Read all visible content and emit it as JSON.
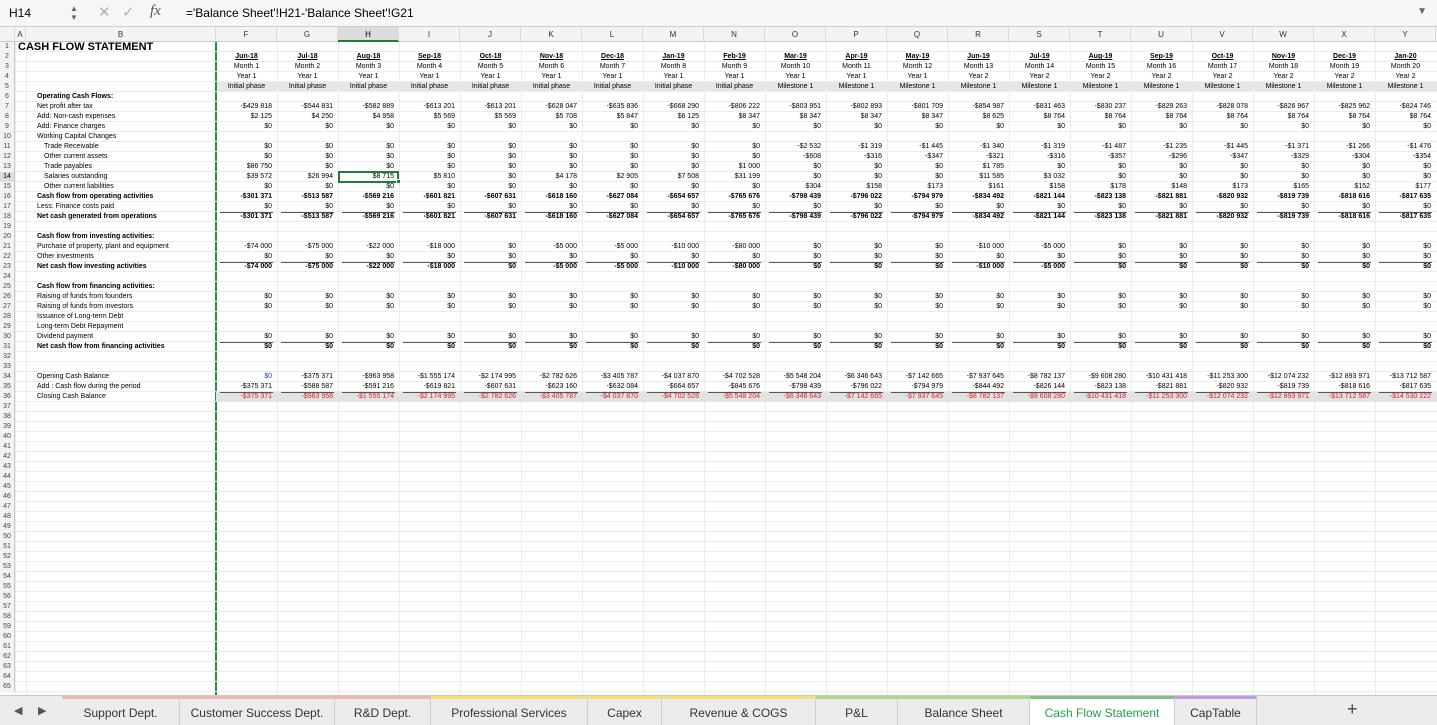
{
  "formula_bar": {
    "name_box": "H14",
    "formula": "='Balance Sheet'!H21-'Balance Sheet'!G21",
    "cancel": "✕",
    "confirm": "✓",
    "fx": "fx"
  },
  "columns": [
    "A",
    "B",
    "F",
    "G",
    "H",
    "I",
    "J",
    "K",
    "L",
    "M",
    "N",
    "O",
    "P",
    "Q",
    "R",
    "S",
    "T",
    "U",
    "V",
    "W",
    "X",
    "Y"
  ],
  "selected_column": "H",
  "selected_row": 14,
  "row_count": 65,
  "title": "CASH FLOW STATEMENT",
  "months": [
    "Jun-18",
    "Jul-18",
    "Aug-18",
    "Sep-18",
    "Oct-18",
    "Nov-18",
    "Dec-18",
    "Jan-19",
    "Feb-19",
    "Mar-19",
    "Apr-19",
    "May-19",
    "Jun-19",
    "Jul-19",
    "Aug-19",
    "Sep-19",
    "Oct-19",
    "Nov-19",
    "Dec-19",
    "Jan-20"
  ],
  "month_numbers": [
    "Month 1",
    "Month 2",
    "Month 3",
    "Month 4",
    "Month 5",
    "Month 6",
    "Month 7",
    "Month 8",
    "Month 9",
    "Month 10",
    "Month 11",
    "Month 12",
    "Month 13",
    "Month 14",
    "Month 15",
    "Month 16",
    "Month 17",
    "Month 18",
    "Month 19",
    "Month 20"
  ],
  "years": [
    "Year 1",
    "Year 1",
    "Year 1",
    "Year 1",
    "Year 1",
    "Year 1",
    "Year 1",
    "Year 1",
    "Year 1",
    "Year 1",
    "Year 1",
    "Year 1",
    "Year 2",
    "Year 2",
    "Year 2",
    "Year 2",
    "Year 2",
    "Year 2",
    "Year 2",
    "Year 2"
  ],
  "phases": [
    "Initial phase",
    "Initial phase",
    "Initial phase",
    "Initial phase",
    "Initial phase",
    "Initial phase",
    "Initial phase",
    "Initial phase",
    "Initial phase",
    "Milestone 1",
    "Milestone 1",
    "Milestone 1",
    "Milestone 1",
    "Milestone 1",
    "Milestone 1",
    "Milestone 1",
    "Milestone 1",
    "Milestone 1",
    "Milestone 1",
    "Milestone 1"
  ],
  "rows": [
    {
      "row": 6,
      "label": "Operating Cash Flows:",
      "style": "bold"
    },
    {
      "row": 7,
      "label": "Net profit after tax",
      "values": [
        "-$429 818",
        "-$544 831",
        "-$582 889",
        "-$613 201",
        "-$613 201",
        "-$628 047",
        "-$635 836",
        "-$668 290",
        "-$806 222",
        "-$803 951",
        "-$802 893",
        "-$801 709",
        "-$854 987",
        "-$831 463",
        "-$830 237",
        "-$829 263",
        "-$828 078",
        "-$826 967",
        "-$825 962",
        "-$824 746"
      ]
    },
    {
      "row": 8,
      "label": "Add: Non-cash expenses",
      "values": [
        "$2 125",
        "$4 250",
        "$4 958",
        "$5 569",
        "$5 569",
        "$5 708",
        "$5 847",
        "$6 125",
        "$8 347",
        "$8 347",
        "$8 347",
        "$8 347",
        "$8 625",
        "$8 764",
        "$8 764",
        "$8 764",
        "$8 764",
        "$8 764",
        "$8 764",
        "$8 764"
      ]
    },
    {
      "row": 9,
      "label": "Add: Finance charges",
      "values": [
        "$0",
        "$0",
        "$0",
        "$0",
        "$0",
        "$0",
        "$0",
        "$0",
        "$0",
        "$0",
        "$0",
        "$0",
        "$0",
        "$0",
        "$0",
        "$0",
        "$0",
        "$0",
        "$0",
        "$0"
      ]
    },
    {
      "row": 10,
      "label": "Working Capital Changes"
    },
    {
      "row": 11,
      "label": "Trade Receivable",
      "indent": true,
      "values": [
        "$0",
        "$0",
        "$0",
        "$0",
        "$0",
        "$0",
        "$0",
        "$0",
        "$0",
        "-$2 532",
        "-$1 319",
        "-$1 445",
        "-$1 340",
        "-$1 319",
        "-$1 487",
        "-$1 235",
        "-$1 445",
        "-$1 371",
        "-$1 266",
        "-$1 476"
      ]
    },
    {
      "row": 12,
      "label": "Other current assets",
      "indent": true,
      "values": [
        "$0",
        "$0",
        "$0",
        "$0",
        "$0",
        "$0",
        "$0",
        "$0",
        "$0",
        "-$608",
        "-$316",
        "-$347",
        "-$321",
        "-$316",
        "-$357",
        "-$296",
        "-$347",
        "-$329",
        "-$304",
        "-$354"
      ]
    },
    {
      "row": 13,
      "label": "Trade payables",
      "indent": true,
      "values": [
        "$86 750",
        "$0",
        "$0",
        "$0",
        "$0",
        "$0",
        "$0",
        "$0",
        "$1 000",
        "$0",
        "$0",
        "$0",
        "$1 785",
        "$0",
        "$0",
        "$0",
        "$0",
        "$0",
        "$0",
        "$0"
      ]
    },
    {
      "row": 14,
      "label": "Salaries outstanding",
      "indent": true,
      "values": [
        "$39 572",
        "$26 994",
        "$8 715",
        "$5 810",
        "$0",
        "$4 178",
        "$2 905",
        "$7 508",
        "$31 199",
        "$0",
        "$0",
        "$0",
        "$11 585",
        "$3 032",
        "$0",
        "$0",
        "$0",
        "$0",
        "$0",
        "$0"
      ]
    },
    {
      "row": 15,
      "label": "Other current liabilities",
      "indent": true,
      "values": [
        "$0",
        "$0",
        "$0",
        "$0",
        "$0",
        "$0",
        "$0",
        "$0",
        "$0",
        "$304",
        "$158",
        "$173",
        "$161",
        "$158",
        "$178",
        "$148",
        "$173",
        "$165",
        "$152",
        "$177"
      ]
    },
    {
      "row": 16,
      "label": "Cash flow from operating activities",
      "style": "bold",
      "values": [
        "-$301 371",
        "-$513 587",
        "-$569 216",
        "-$601 821",
        "-$607 631",
        "-$618 160",
        "-$627 084",
        "-$654 657",
        "-$765 676",
        "-$798 439",
        "-$796 022",
        "-$794 979",
        "-$834 492",
        "-$821 144",
        "-$823 138",
        "-$821 881",
        "-$820 932",
        "-$819 739",
        "-$818 616",
        "-$817 635"
      ]
    },
    {
      "row": 17,
      "label": "Less: Finance costs paid",
      "values": [
        "$0",
        "$0",
        "$0",
        "$0",
        "$0",
        "$0",
        "$0",
        "$0",
        "$0",
        "$0",
        "$0",
        "$0",
        "$0",
        "$0",
        "$0",
        "$0",
        "$0",
        "$0",
        "$0",
        "$0"
      ]
    },
    {
      "row": 18,
      "label": "Net cash generated from operations",
      "style": "bold",
      "values": [
        "-$301 371",
        "-$513 587",
        "-$569 216",
        "-$601 821",
        "-$607 631",
        "-$618 160",
        "-$627 084",
        "-$654 657",
        "-$765 676",
        "-$798 439",
        "-$796 022",
        "-$794 979",
        "-$834 492",
        "-$821 144",
        "-$823 138",
        "-$821 881",
        "-$820 932",
        "-$819 739",
        "-$818 616",
        "-$817 635"
      ]
    },
    {
      "row": 20,
      "label": "Cash flow from investing activities:",
      "style": "bold"
    },
    {
      "row": 21,
      "label": "Purchase of property, plant and equipment",
      "values": [
        "-$74 000",
        "-$75 000",
        "-$22 000",
        "-$18 000",
        "$0",
        "-$5 000",
        "-$5 000",
        "-$10 000",
        "-$80 000",
        "$0",
        "$0",
        "$0",
        "-$10 000",
        "-$5 000",
        "$0",
        "$0",
        "$0",
        "$0",
        "$0",
        "$0"
      ]
    },
    {
      "row": 22,
      "label": "Other investments",
      "values": [
        "$0",
        "$0",
        "$0",
        "$0",
        "$0",
        "$0",
        "$0",
        "$0",
        "$0",
        "$0",
        "$0",
        "$0",
        "$0",
        "$0",
        "$0",
        "$0",
        "$0",
        "$0",
        "$0",
        "$0"
      ]
    },
    {
      "row": 23,
      "label": "Net cash flow investing activities",
      "style": "bold",
      "values": [
        "-$74 000",
        "-$75 000",
        "-$22 000",
        "-$18 000",
        "$0",
        "-$5 000",
        "-$5 000",
        "-$10 000",
        "-$80 000",
        "$0",
        "$0",
        "$0",
        "-$10 000",
        "-$5 000",
        "$0",
        "$0",
        "$0",
        "$0",
        "$0",
        "$0"
      ]
    },
    {
      "row": 25,
      "label": "Cash flow from financing activities:",
      "style": "bold"
    },
    {
      "row": 26,
      "label": "Raising of funds from founders",
      "values": [
        "$0",
        "$0",
        "$0",
        "$0",
        "$0",
        "$0",
        "$0",
        "$0",
        "$0",
        "$0",
        "$0",
        "$0",
        "$0",
        "$0",
        "$0",
        "$0",
        "$0",
        "$0",
        "$0",
        "$0"
      ]
    },
    {
      "row": 27,
      "label": "Raising of funds from investors",
      "values": [
        "$0",
        "$0",
        "$0",
        "$0",
        "$0",
        "$0",
        "$0",
        "$0",
        "$0",
        "$0",
        "$0",
        "$0",
        "$0",
        "$0",
        "$0",
        "$0",
        "$0",
        "$0",
        "$0",
        "$0"
      ]
    },
    {
      "row": 28,
      "label": "Issuance of Long-term Debt"
    },
    {
      "row": 29,
      "label": "Long-term Debt Repayment"
    },
    {
      "row": 30,
      "label": "Dividend payment",
      "values": [
        "$0",
        "$0",
        "$0",
        "$0",
        "$0",
        "$0",
        "$0",
        "$0",
        "$0",
        "$0",
        "$0",
        "$0",
        "$0",
        "$0",
        "$0",
        "$0",
        "$0",
        "$0",
        "$0",
        "$0"
      ]
    },
    {
      "row": 31,
      "label": "Net cash flow from financing activities",
      "style": "bold",
      "values": [
        "$0",
        "$0",
        "$0",
        "$0",
        "$0",
        "$0",
        "$0",
        "$0",
        "$0",
        "$0",
        "$0",
        "$0",
        "$0",
        "$0",
        "$0",
        "$0",
        "$0",
        "$0",
        "$0",
        "$0"
      ]
    },
    {
      "row": 34,
      "label": "Opening Cash Balance",
      "first_blue": true,
      "values": [
        "$0",
        "-$375 371",
        "-$963 958",
        "-$1 555 174",
        "-$2 174 995",
        "-$2 782 626",
        "-$3 405 787",
        "-$4 037 870",
        "-$4 702 528",
        "-$5 548 204",
        "-$6 346 643",
        "-$7 142 665",
        "-$7 937 645",
        "-$8 782 137",
        "-$9 608 280",
        "-$10 431 418",
        "-$11 253 300",
        "-$12 074 232",
        "-$12 893 971",
        "-$13 712 587"
      ]
    },
    {
      "row": 35,
      "label": "Add : Cash flow during the period",
      "values": [
        "-$375 371",
        "-$588 587",
        "-$591 216",
        "-$619 821",
        "-$607 631",
        "-$623 160",
        "-$632 084",
        "-$664 657",
        "-$845 676",
        "-$798 439",
        "-$796 022",
        "-$794 979",
        "-$844 492",
        "-$826 144",
        "-$823 138",
        "-$821 881",
        "-$820 932",
        "-$819 739",
        "-$818 616",
        "-$817 635"
      ]
    },
    {
      "row": 36,
      "label": "Closing Cash Balance",
      "style": "closing",
      "values": [
        "-$375 371",
        "-$963 958",
        "-$1 555 174",
        "-$2 174 995",
        "-$2 782 626",
        "-$3 405 787",
        "-$4 037 870",
        "-$4 702 528",
        "-$5 548 204",
        "-$6 346 643",
        "-$7 142 665",
        "-$7 937 645",
        "-$8 782 137",
        "-$9 608 280",
        "-$10 431 418",
        "-$11 253 300",
        "-$12 074 232",
        "-$12 893 971",
        "-$13 712 587",
        "-$14 530 222"
      ]
    }
  ],
  "sheet_tabs": [
    {
      "label": "Support Dept.",
      "color": "#f2b8b0"
    },
    {
      "label": "Customer Success Dept.",
      "color": "#f2b8b0"
    },
    {
      "label": "R&D Dept.",
      "color": "#f2b8b0"
    },
    {
      "label": "Professional Services",
      "color": "#f7e27a"
    },
    {
      "label": "Capex",
      "color": "#f7e27a"
    },
    {
      "label": "Revenue & COGS Projections",
      "color": "#f7e27a"
    },
    {
      "label": "P&L",
      "color": "#a9d98a"
    },
    {
      "label": "Balance Sheet",
      "color": "#a9d98a"
    },
    {
      "label": "Cash Flow Statement",
      "color": "#7ec38f",
      "active": true
    },
    {
      "label": "CapTable",
      "color": "#c39ce0"
    }
  ],
  "add_sheet": "+"
}
